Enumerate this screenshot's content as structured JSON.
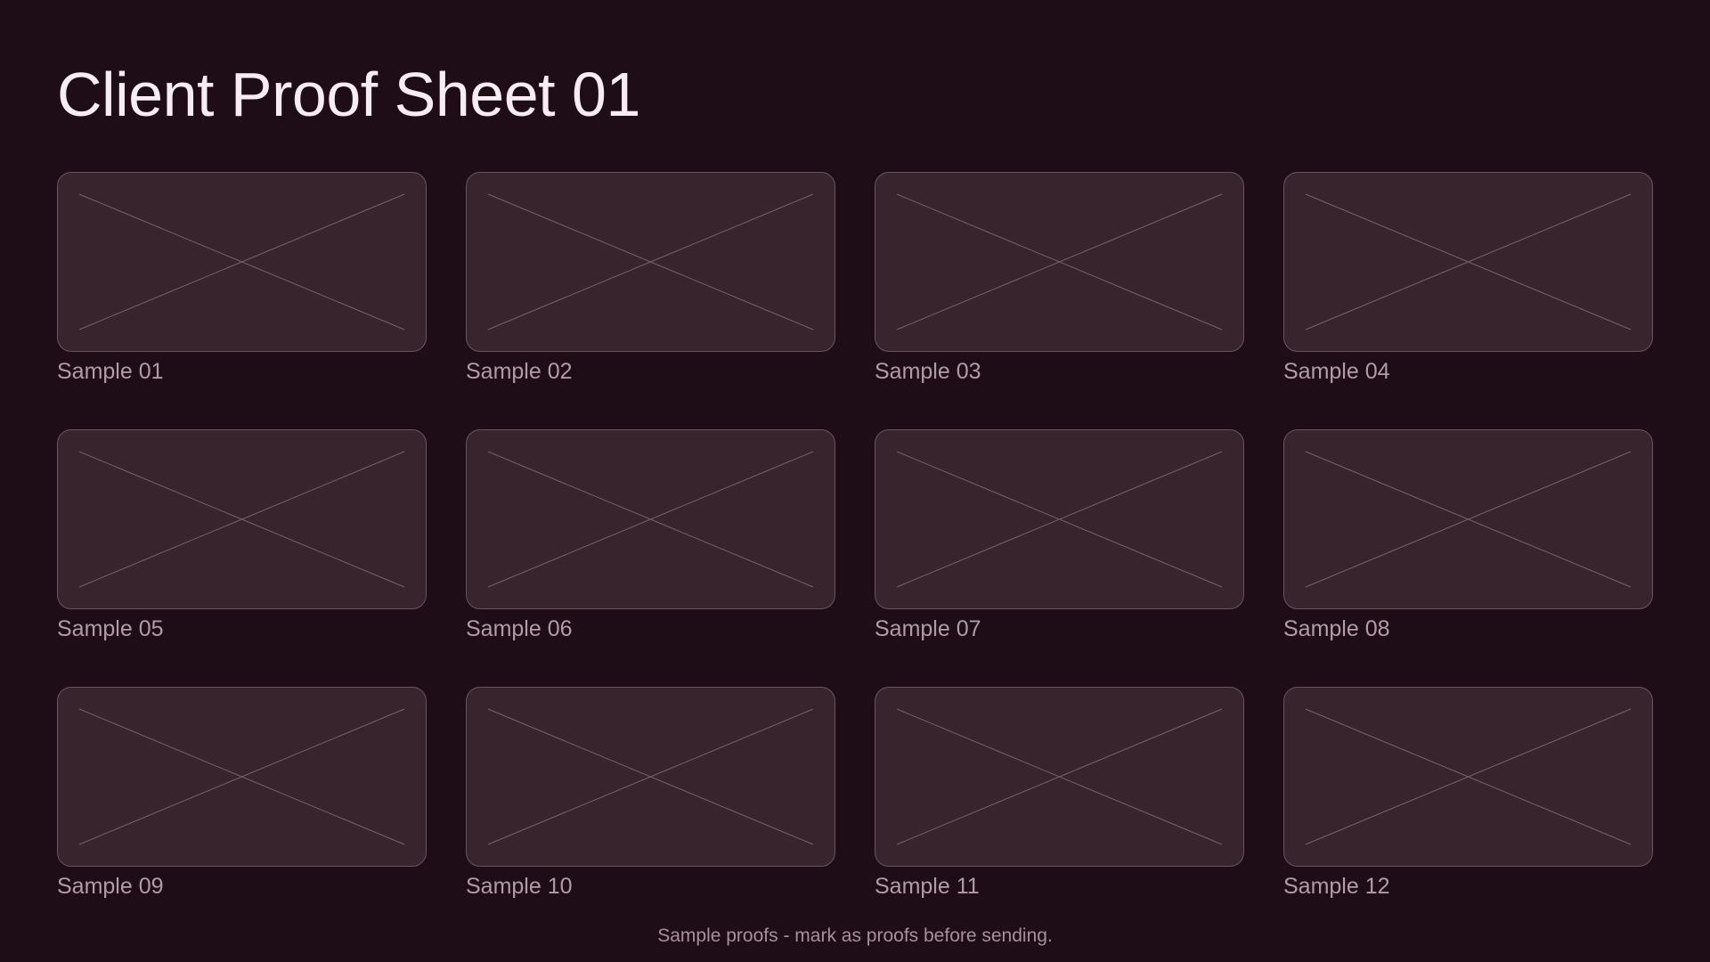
{
  "page": {
    "title": "Client Proof Sheet 01",
    "footer_note": "Sample proofs - mark as proofs before sending."
  },
  "samples": [
    {
      "label": "Sample 01"
    },
    {
      "label": "Sample 02"
    },
    {
      "label": "Sample 03"
    },
    {
      "label": "Sample 04"
    },
    {
      "label": "Sample 05"
    },
    {
      "label": "Sample 06"
    },
    {
      "label": "Sample 07"
    },
    {
      "label": "Sample 08"
    },
    {
      "label": "Sample 09"
    },
    {
      "label": "Sample 10"
    },
    {
      "label": "Sample 11"
    },
    {
      "label": "Sample 12"
    }
  ],
  "placeholder_icon": "image-placeholder-cross-icon",
  "colors": {
    "background": "#1e0d17",
    "card_fill": "#37242d",
    "card_border": "#6b5360",
    "cross_line": "#7a6070",
    "label_text": "#b39aa7",
    "title_text": "#f7ecf2"
  }
}
